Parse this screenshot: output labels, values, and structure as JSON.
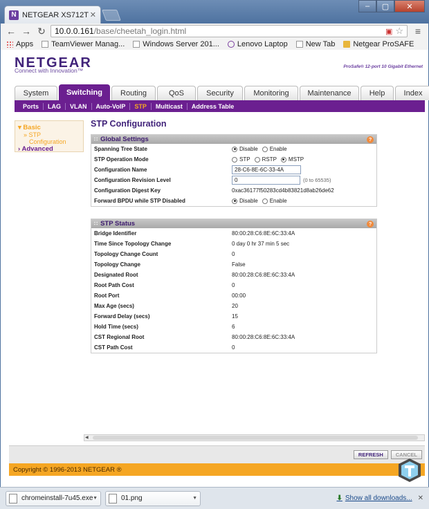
{
  "browser": {
    "tab_title": "NETGEAR XS712T",
    "tab_favicon": "N",
    "url_host": "10.0.0.161",
    "url_path": "/base/cheetah_login.html",
    "bookmarks": [
      {
        "label": "Apps",
        "icon": "apps-icon"
      },
      {
        "label": "TeamViewer Manag...",
        "icon": "document-icon"
      },
      {
        "label": "Windows Server 201...",
        "icon": "document-icon"
      },
      {
        "label": "Lenovo Laptop",
        "icon": "peace-icon"
      },
      {
        "label": "New Tab",
        "icon": "document-icon"
      },
      {
        "label": "Netgear ProSAFE",
        "icon": "folder-icon"
      }
    ]
  },
  "header": {
    "logo": "NETGEAR",
    "tagline": "Connect with Innovation™",
    "product": "ProSafe® 12-port 10 Gigabit Ethernet"
  },
  "main_tabs": [
    {
      "label": "System",
      "active": false
    },
    {
      "label": "Switching",
      "active": true
    },
    {
      "label": "Routing",
      "active": false
    },
    {
      "label": "QoS",
      "active": false
    },
    {
      "label": "Security",
      "active": false
    },
    {
      "label": "Monitoring",
      "active": false
    },
    {
      "label": "Maintenance",
      "active": false
    },
    {
      "label": "Help",
      "active": false
    },
    {
      "label": "Index",
      "active": false
    }
  ],
  "sub_nav": [
    {
      "label": "Ports",
      "active": false
    },
    {
      "label": "LAG",
      "active": false
    },
    {
      "label": "VLAN",
      "active": false
    },
    {
      "label": "Auto-VoIP",
      "active": false
    },
    {
      "label": "STP",
      "active": true
    },
    {
      "label": "Multicast",
      "active": false
    },
    {
      "label": "Address Table",
      "active": false
    }
  ],
  "sidebar": {
    "basic": "Basic",
    "stp": "STP",
    "configuration": "Configuration",
    "advanced": "Advanced"
  },
  "page_title": "STP Configuration",
  "global_settings": {
    "title": "Global Settings",
    "spanning_tree_state_label": "Spanning Tree State",
    "spanning_tree_options": [
      "Disable",
      "Enable"
    ],
    "spanning_tree_selected": "Disable",
    "operation_mode_label": "STP Operation Mode",
    "operation_mode_options": [
      "STP",
      "RSTP",
      "MSTP"
    ],
    "operation_mode_selected": "MSTP",
    "config_name_label": "Configuration Name",
    "config_name_value": "28-C6-8E-6C-33-4A",
    "config_revision_label": "Configuration Revision Level",
    "config_revision_value": "0",
    "config_revision_hint": "(0 to 65535)",
    "digest_key_label": "Configuration Digest Key",
    "digest_key_value": "0xac36177f50283cd4b83821d8ab26de62",
    "forward_bpdu_label": "Forward BPDU while STP Disabled",
    "forward_bpdu_options": [
      "Disable",
      "Enable"
    ],
    "forward_bpdu_selected": "Disable"
  },
  "stp_status": {
    "title": "STP Status",
    "rows": [
      {
        "label": "Bridge Identifier",
        "value": "80:00:28:C6:8E:6C:33:4A"
      },
      {
        "label": "Time Since Topology Change",
        "value": "0 day 0 hr 37 min 5 sec"
      },
      {
        "label": "Topology Change Count",
        "value": "0"
      },
      {
        "label": "Topology Change",
        "value": "False"
      },
      {
        "label": "Designated Root",
        "value": "80:00:28:C6:8E:6C:33:4A"
      },
      {
        "label": "Root Path Cost",
        "value": "0"
      },
      {
        "label": "Root Port",
        "value": "00:00"
      },
      {
        "label": "Max Age (secs)",
        "value": "20"
      },
      {
        "label": "Forward Delay (secs)",
        "value": "15"
      },
      {
        "label": "Hold Time (secs)",
        "value": "6"
      },
      {
        "label": "CST Regional Root",
        "value": "80:00:28:C6:8E:6C:33:4A"
      },
      {
        "label": "CST Path Cost",
        "value": "0"
      }
    ]
  },
  "buttons": {
    "refresh": "REFRESH",
    "cancel": "CANCEL"
  },
  "footer": "Copyright © 1996-2013 NETGEAR ®",
  "downloads": {
    "items": [
      "chromeinstall-7u45.exe",
      "01.png"
    ],
    "show_all": "Show all downloads..."
  }
}
